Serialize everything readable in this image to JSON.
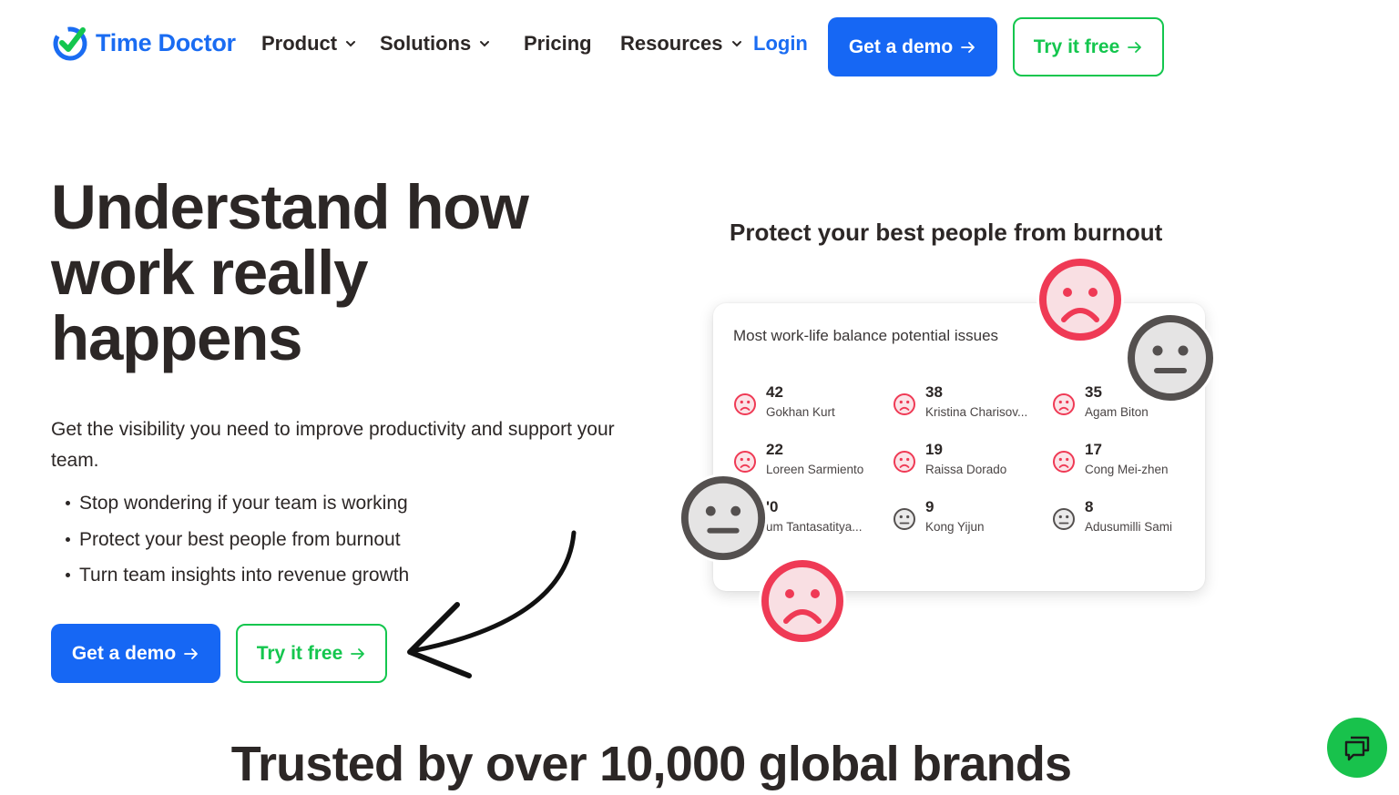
{
  "brand": {
    "name": "Time Doctor"
  },
  "nav": {
    "items": [
      {
        "label": "Product",
        "has_dropdown": true
      },
      {
        "label": "Solutions",
        "has_dropdown": true
      },
      {
        "label": "Pricing",
        "has_dropdown": false
      },
      {
        "label": "Resources",
        "has_dropdown": true
      }
    ],
    "login": "Login",
    "demo_button": "Get a demo",
    "free_button": "Try it free"
  },
  "hero": {
    "title": "Understand how work really happens",
    "subtitle": "Get the visibility you need to improve productivity and support your team.",
    "bullets": [
      "Stop wondering if your team is working",
      "Protect your best people from burnout",
      "Turn team insights into revenue growth"
    ],
    "demo_button": "Get a demo",
    "free_button": "Try it free"
  },
  "feature": {
    "title": "Protect your best people from burnout",
    "card_heading": "Most work-life balance potential issues",
    "entries": [
      {
        "count": "42",
        "name": "Gokhan Kurt",
        "mood": "sad"
      },
      {
        "count": "38",
        "name": "Kristina Charisov...",
        "mood": "sad"
      },
      {
        "count": "35",
        "name": "Agam Biton",
        "mood": "sad"
      },
      {
        "count": "22",
        "name": "Loreen Sarmiento",
        "mood": "sad"
      },
      {
        "count": "19",
        "name": "Raissa Dorado",
        "mood": "sad"
      },
      {
        "count": "17",
        "name": "Cong Mei-zhen",
        "mood": "sad"
      },
      {
        "count": "'0",
        "name": "um Tantasatitya...",
        "mood": "neutral"
      },
      {
        "count": "9",
        "name": "Kong Yijun",
        "mood": "neutral"
      },
      {
        "count": "8",
        "name": "Adusumilli Sami",
        "mood": "neutral"
      }
    ]
  },
  "trusted": {
    "heading": "Trusted by over 10,000 global brands"
  },
  "colors": {
    "primary_blue": "#1667f4",
    "brand_green": "#14c64e",
    "sad_red": "#ef3a55",
    "neutral_gray": "#54504f",
    "text_dark": "#2c2726"
  },
  "icons": [
    "logo-check-icon",
    "chevron-down-icon",
    "arrow-right-icon",
    "sad-face-icon",
    "neutral-face-icon",
    "curved-arrow-icon",
    "chat-icon"
  ]
}
